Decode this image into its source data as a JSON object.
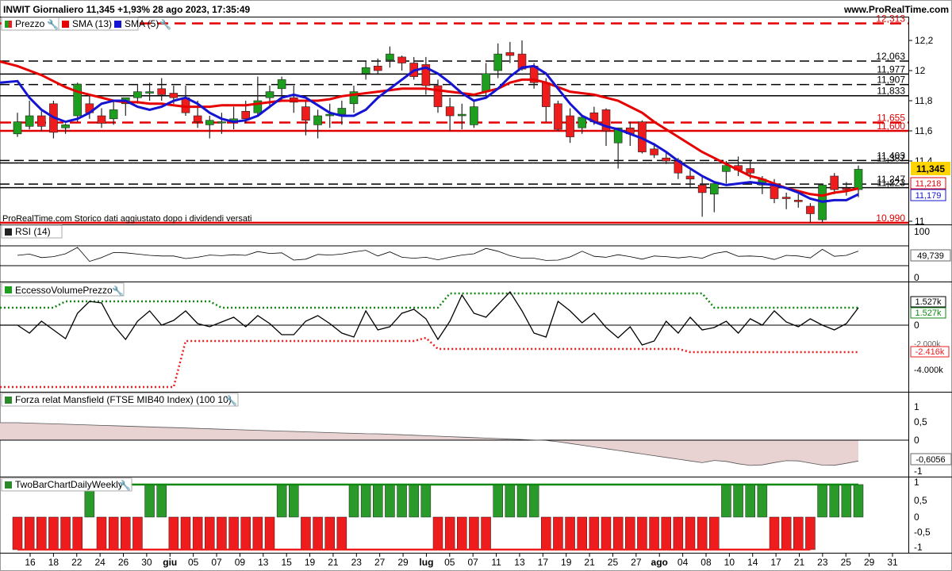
{
  "header": {
    "title": "INWIT Giornaliero 11,345 +1,93% 28 ago 2023, 17:35:49",
    "brand": "www.ProRealTime.com"
  },
  "price_panel": {
    "legend": [
      "Prezzo",
      "SMA (13)",
      "SMA (5)"
    ],
    "note": "ProRealTime.com Storico dati aggiustato dopo i dividendi versati",
    "level_labels": [
      {
        "text": "12,313",
        "value": 12.313,
        "color": "#e00000"
      },
      {
        "text": "12,063",
        "value": 12.063,
        "color": "#000000"
      },
      {
        "text": "11,977",
        "value": 11.977,
        "color": "#000000"
      },
      {
        "text": "11,907",
        "value": 11.907,
        "color": "#000000"
      },
      {
        "text": "11,833",
        "value": 11.833,
        "color": "#000000"
      },
      {
        "text": "11,655",
        "value": 11.655,
        "color": "#e00000"
      },
      {
        "text": "11,600",
        "value": 11.6,
        "color": "#e00000"
      },
      {
        "text": "11,403",
        "value": 11.403,
        "color": "#000000"
      },
      {
        "text": "11,387",
        "value": 11.387,
        "color": "#000000"
      },
      {
        "text": "11,247",
        "value": 11.247,
        "color": "#000000"
      },
      {
        "text": "11,223",
        "value": 11.223,
        "color": "#000000"
      },
      {
        "text": "10,990",
        "value": 10.99,
        "color": "#e00000"
      }
    ],
    "axis_ticks": [
      "12,2",
      "12",
      "11,8",
      "11,6",
      "11,4",
      "11"
    ],
    "last_price": "11,345",
    "sma13_last": "11,218",
    "sma5_last": "11,179"
  },
  "rsi_panel": {
    "label": "RSI (14)",
    "axis_ticks": [
      "100",
      "0"
    ],
    "last_value": "49,739"
  },
  "evp_panel": {
    "label": "EccessoVolumePrezzo",
    "axis_ticks": [
      "0",
      "-4.000k"
    ],
    "upper_value": "1.527k",
    "upper_value_green": "1.527k",
    "lower_value": "-2.416k",
    "lower_value_partial": "-2.000k"
  },
  "mansfield_panel": {
    "label": "Forza relat Mansfield (FTSE MIB40 Index) (100 10)",
    "axis_ticks": [
      "1",
      "0,5",
      "0",
      "-1"
    ],
    "last_value": "-0,6056"
  },
  "twobar_panel": {
    "label": "TwoBarChartDailyWeekly",
    "axis_ticks": [
      "1",
      "0,5",
      "0",
      "-0,5",
      "-1"
    ]
  },
  "x_axis": {
    "labels": [
      "16",
      "18",
      "22",
      "24",
      "26",
      "30",
      "giu",
      "05",
      "07",
      "09",
      "13",
      "15",
      "19",
      "21",
      "23",
      "27",
      "29",
      "lug",
      "05",
      "07",
      "11",
      "13",
      "17",
      "19",
      "21",
      "25",
      "27",
      "ago",
      "04",
      "08",
      "10",
      "14",
      "17",
      "21",
      "23",
      "25",
      "29",
      "31"
    ]
  },
  "colors": {
    "up": "#1e9e1e",
    "down": "#ee1c1c",
    "sma13": "#e60000",
    "sma5": "#1414d2",
    "level_red": "#e00000"
  },
  "chart_data": {
    "type": "candlestick",
    "title": "INWIT Giornaliero",
    "ylim": [
      10.96,
      12.37
    ],
    "candles": [
      {
        "o": 11.58,
        "h": 11.72,
        "l": 11.56,
        "c": 11.66
      },
      {
        "o": 11.63,
        "h": 11.8,
        "l": 11.61,
        "c": 11.7
      },
      {
        "o": 11.7,
        "h": 11.73,
        "l": 11.6,
        "c": 11.63
      },
      {
        "o": 11.78,
        "h": 11.8,
        "l": 11.55,
        "c": 11.59
      },
      {
        "o": 11.62,
        "h": 11.65,
        "l": 11.58,
        "c": 11.64
      },
      {
        "o": 11.7,
        "h": 11.92,
        "l": 11.66,
        "c": 11.91
      },
      {
        "o": 11.78,
        "h": 11.84,
        "l": 11.68,
        "c": 11.72
      },
      {
        "o": 11.7,
        "h": 11.75,
        "l": 11.62,
        "c": 11.65
      },
      {
        "o": 11.68,
        "h": 11.8,
        "l": 11.64,
        "c": 11.74
      },
      {
        "o": 11.78,
        "h": 11.82,
        "l": 11.7,
        "c": 11.82
      },
      {
        "o": 11.82,
        "h": 11.91,
        "l": 11.78,
        "c": 11.86
      },
      {
        "o": 11.85,
        "h": 11.92,
        "l": 11.8,
        "c": 11.86
      },
      {
        "o": 11.88,
        "h": 11.95,
        "l": 11.8,
        "c": 11.84
      },
      {
        "o": 11.85,
        "h": 11.9,
        "l": 11.78,
        "c": 11.82
      },
      {
        "o": 11.82,
        "h": 11.9,
        "l": 11.7,
        "c": 11.72
      },
      {
        "o": 11.7,
        "h": 11.8,
        "l": 11.62,
        "c": 11.66
      },
      {
        "o": 11.64,
        "h": 11.7,
        "l": 11.55,
        "c": 11.67
      },
      {
        "o": 11.66,
        "h": 11.72,
        "l": 11.58,
        "c": 11.66
      },
      {
        "o": 11.66,
        "h": 11.76,
        "l": 11.61,
        "c": 11.68
      },
      {
        "o": 11.73,
        "h": 11.8,
        "l": 11.65,
        "c": 11.68
      },
      {
        "o": 11.72,
        "h": 11.96,
        "l": 11.7,
        "c": 11.8
      },
      {
        "o": 11.82,
        "h": 11.9,
        "l": 11.75,
        "c": 11.86
      },
      {
        "o": 11.88,
        "h": 11.96,
        "l": 11.8,
        "c": 11.94
      },
      {
        "o": 11.82,
        "h": 11.9,
        "l": 11.72,
        "c": 11.79
      },
      {
        "o": 11.76,
        "h": 11.8,
        "l": 11.57,
        "c": 11.67
      },
      {
        "o": 11.64,
        "h": 11.74,
        "l": 11.55,
        "c": 11.7
      },
      {
        "o": 11.7,
        "h": 11.78,
        "l": 11.62,
        "c": 11.71
      },
      {
        "o": 11.71,
        "h": 11.8,
        "l": 11.64,
        "c": 11.75
      },
      {
        "o": 11.78,
        "h": 11.9,
        "l": 11.72,
        "c": 11.86
      },
      {
        "o": 11.98,
        "h": 12.06,
        "l": 11.94,
        "c": 12.02
      },
      {
        "o": 12.03,
        "h": 12.08,
        "l": 11.98,
        "c": 12.0
      },
      {
        "o": 12.07,
        "h": 12.16,
        "l": 12.02,
        "c": 12.11
      },
      {
        "o": 12.09,
        "h": 12.1,
        "l": 12.0,
        "c": 12.05
      },
      {
        "o": 12.05,
        "h": 12.09,
        "l": 11.94,
        "c": 11.96
      },
      {
        "o": 12.04,
        "h": 12.09,
        "l": 11.84,
        "c": 11.9
      },
      {
        "o": 11.9,
        "h": 11.94,
        "l": 11.72,
        "c": 11.76
      },
      {
        "o": 11.76,
        "h": 11.82,
        "l": 11.6,
        "c": 11.7
      },
      {
        "o": 11.7,
        "h": 11.78,
        "l": 11.61,
        "c": 11.71
      },
      {
        "o": 11.64,
        "h": 11.8,
        "l": 11.62,
        "c": 11.76
      },
      {
        "o": 11.86,
        "h": 12.05,
        "l": 11.82,
        "c": 11.98
      },
      {
        "o": 12.0,
        "h": 12.18,
        "l": 11.95,
        "c": 12.11
      },
      {
        "o": 12.12,
        "h": 12.19,
        "l": 12.05,
        "c": 12.1
      },
      {
        "o": 12.11,
        "h": 12.2,
        "l": 12.0,
        "c": 12.01
      },
      {
        "o": 12.03,
        "h": 12.05,
        "l": 11.88,
        "c": 11.92
      },
      {
        "o": 11.92,
        "h": 11.95,
        "l": 11.66,
        "c": 11.76
      },
      {
        "o": 11.78,
        "h": 11.8,
        "l": 11.6,
        "c": 11.61
      },
      {
        "o": 11.7,
        "h": 11.75,
        "l": 11.52,
        "c": 11.56
      },
      {
        "o": 11.62,
        "h": 11.7,
        "l": 11.58,
        "c": 11.69
      },
      {
        "o": 11.72,
        "h": 11.76,
        "l": 11.64,
        "c": 11.66
      },
      {
        "o": 11.74,
        "h": 11.75,
        "l": 11.5,
        "c": 11.6
      },
      {
        "o": 11.52,
        "h": 11.6,
        "l": 11.35,
        "c": 11.62
      },
      {
        "o": 11.62,
        "h": 11.66,
        "l": 11.5,
        "c": 11.58
      },
      {
        "o": 11.66,
        "h": 11.67,
        "l": 11.45,
        "c": 11.46
      },
      {
        "o": 11.48,
        "h": 11.52,
        "l": 11.42,
        "c": 11.44
      },
      {
        "o": 11.42,
        "h": 11.46,
        "l": 11.38,
        "c": 11.4
      },
      {
        "o": 11.4,
        "h": 11.42,
        "l": 11.28,
        "c": 11.32
      },
      {
        "o": 11.3,
        "h": 11.34,
        "l": 11.22,
        "c": 11.28
      },
      {
        "o": 11.24,
        "h": 11.3,
        "l": 11.03,
        "c": 11.19
      },
      {
        "o": 11.18,
        "h": 11.25,
        "l": 11.06,
        "c": 11.25
      },
      {
        "o": 11.33,
        "h": 11.4,
        "l": 11.25,
        "c": 11.37
      },
      {
        "o": 11.37,
        "h": 11.43,
        "l": 11.3,
        "c": 11.34
      },
      {
        "o": 11.35,
        "h": 11.4,
        "l": 11.28,
        "c": 11.32
      },
      {
        "o": 11.24,
        "h": 11.3,
        "l": 11.18,
        "c": 11.28
      },
      {
        "o": 11.24,
        "h": 11.28,
        "l": 11.12,
        "c": 11.15
      },
      {
        "o": 11.16,
        "h": 11.19,
        "l": 11.08,
        "c": 11.15
      },
      {
        "o": 11.14,
        "h": 11.18,
        "l": 11.09,
        "c": 11.13
      },
      {
        "o": 11.1,
        "h": 11.12,
        "l": 10.99,
        "c": 11.05
      },
      {
        "o": 11.01,
        "h": 11.25,
        "l": 10.99,
        "c": 11.24
      },
      {
        "o": 11.3,
        "h": 11.32,
        "l": 11.18,
        "c": 11.21
      },
      {
        "o": 11.22,
        "h": 11.26,
        "l": 11.17,
        "c": 11.21
      },
      {
        "o": 11.21,
        "h": 11.37,
        "l": 11.16,
        "c": 11.345
      }
    ],
    "sma13": [
      12.03,
      12.0,
      11.97,
      11.93,
      11.89,
      11.86,
      11.84,
      11.82,
      11.8,
      11.79,
      11.79,
      11.78,
      11.78,
      11.77,
      11.76,
      11.76,
      11.76,
      11.77,
      11.77,
      11.77,
      11.78,
      11.79,
      11.8,
      11.8,
      11.8,
      11.8,
      11.81,
      11.83,
      11.84,
      11.85,
      11.86,
      11.87,
      11.88,
      11.88,
      11.88,
      11.87,
      11.86,
      11.85,
      11.84,
      11.86,
      11.88,
      11.92,
      11.94,
      11.94,
      11.92,
      11.89,
      11.86,
      11.85,
      11.84,
      11.82,
      11.8,
      11.76,
      11.72,
      11.66,
      11.61,
      11.56,
      11.51,
      11.46,
      11.42,
      11.38,
      11.34,
      11.3,
      11.28,
      11.25,
      11.22,
      11.2,
      11.18,
      11.17,
      11.19,
      11.2,
      11.218
    ],
    "sma5": [
      11.93,
      11.82,
      11.74,
      11.69,
      11.66,
      11.68,
      11.72,
      11.78,
      11.8,
      11.8,
      11.76,
      11.74,
      11.76,
      11.8,
      11.82,
      11.78,
      11.72,
      11.68,
      11.66,
      11.67,
      11.7,
      11.76,
      11.82,
      11.84,
      11.82,
      11.77,
      11.72,
      11.7,
      11.7,
      11.74,
      11.82,
      11.88,
      11.94,
      12.0,
      12.02,
      11.98,
      11.92,
      11.85,
      11.8,
      11.82,
      11.88,
      11.96,
      12.02,
      12.03,
      11.98,
      11.88,
      11.78,
      11.7,
      11.66,
      11.63,
      11.61,
      11.58,
      11.55,
      11.51,
      11.46,
      11.4,
      11.35,
      11.3,
      11.26,
      11.24,
      11.25,
      11.26,
      11.25,
      11.24,
      11.22,
      11.19,
      11.15,
      11.13,
      11.14,
      11.14,
      11.179
    ]
  }
}
